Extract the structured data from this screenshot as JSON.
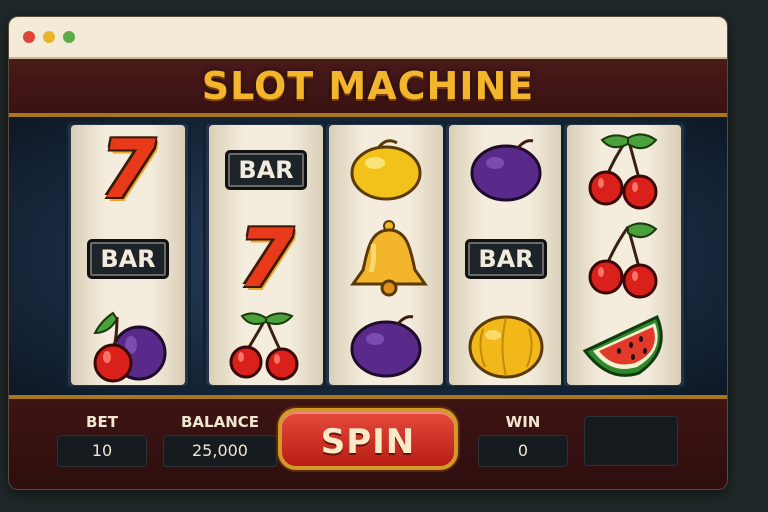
{
  "window": {
    "title": "SLOT MACHINE"
  },
  "reels": [
    {
      "symbols": [
        "seven",
        "bar",
        "cherry-plum"
      ]
    },
    {
      "symbols": [
        "bar",
        "seven",
        "cherries"
      ]
    },
    {
      "symbols": [
        "lemon",
        "bell",
        "plum"
      ]
    },
    {
      "symbols": [
        "plum",
        "bar",
        "melon"
      ]
    },
    {
      "symbols": [
        "cherries",
        "cherries",
        "watermelon"
      ]
    }
  ],
  "labels": {
    "seven": "7",
    "bar": "BAR"
  },
  "stats": {
    "bet_label": "BET",
    "bet_value": "10",
    "balance_label": "BALANCE",
    "balance_value": "25,000",
    "win_label": "WIN",
    "win_value": "0"
  },
  "spin": {
    "label": "SPIN"
  },
  "colors": {
    "accent": "#f2b52c",
    "spin": "#d42a1c",
    "frame": "#3a1212"
  }
}
